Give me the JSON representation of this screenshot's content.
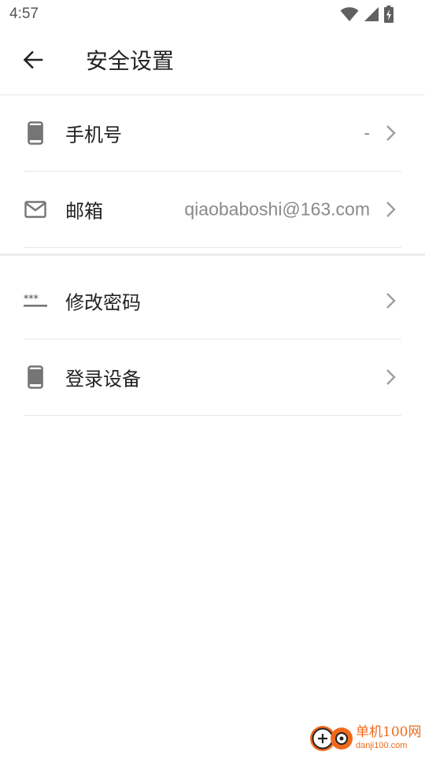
{
  "status_bar": {
    "time": "4:57",
    "icons": [
      "wifi-icon",
      "signal-icon",
      "battery-charging-icon"
    ]
  },
  "app_bar": {
    "title": "安全设置",
    "back_icon": "arrow-left-icon"
  },
  "groups": [
    {
      "items": [
        {
          "icon": "smartphone-icon",
          "label": "手机号",
          "value": "-"
        },
        {
          "icon": "mail-icon",
          "label": "邮箱",
          "value": "qiaobaboshi@163.com"
        }
      ]
    },
    {
      "items": [
        {
          "icon": "password-dots-icon",
          "label": "修改密码",
          "value": ""
        },
        {
          "icon": "smartphone-icon",
          "label": "登录设备",
          "value": ""
        }
      ]
    }
  ],
  "watermark": {
    "text_cn": "单机100网",
    "text_en": "danji100.com"
  },
  "colors": {
    "icon_gray": "#757575",
    "chevron_gray": "#9e9e9e",
    "divider": "#e6e6e6",
    "watermark_orange": "#f06a1c"
  }
}
